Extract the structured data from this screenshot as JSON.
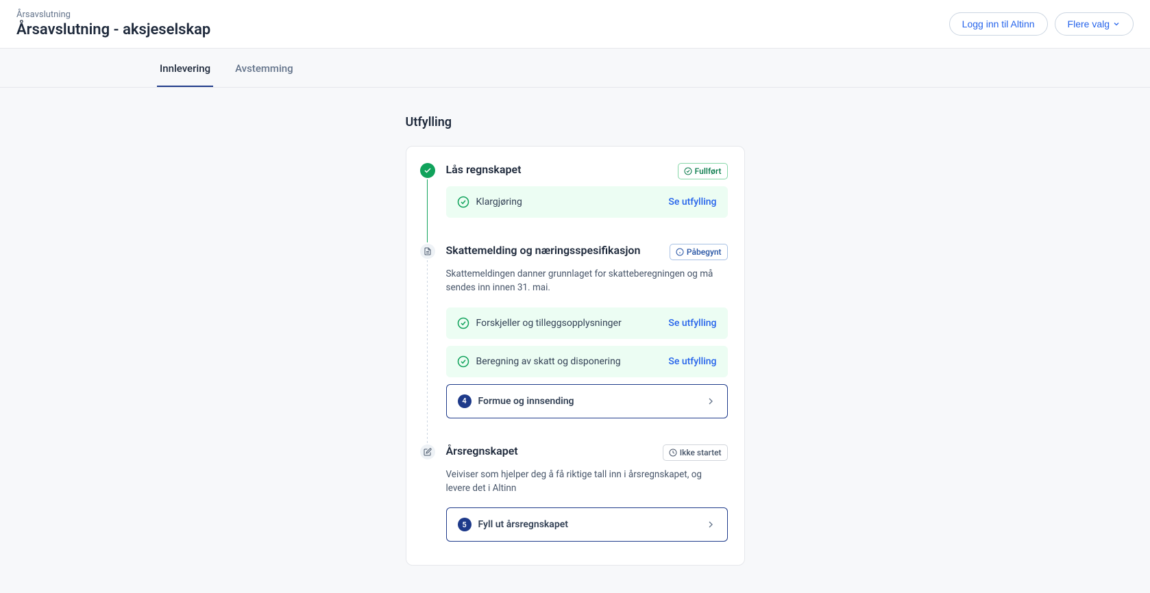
{
  "header": {
    "breadcrumb": "Årsavslutning",
    "title": "Årsavslutning - aksjeselskap",
    "btn_login": "Logg inn til Altinn",
    "btn_more": "Flere valg"
  },
  "tabs": {
    "innlevering": "Innlevering",
    "avstemming": "Avstemming"
  },
  "section": {
    "title": "Utfylling"
  },
  "steps": {
    "s1": {
      "title": "Lås regnskapet",
      "badge": "Fullført",
      "sub1": {
        "label": "Klargjøring",
        "link": "Se utfylling"
      }
    },
    "s2": {
      "title": "Skattemelding og næringsspesifikasjon",
      "badge": "Påbegynt",
      "desc": "Skattemeldingen danner grunnlaget for skatteberegningen og må sendes inn innen 31. mai.",
      "sub1": {
        "label": "Forskjeller og tilleggsopplysninger",
        "link": "Se utfylling"
      },
      "sub2": {
        "label": "Beregning av skatt og disponering",
        "link": "Se utfylling"
      },
      "sub3": {
        "num": "4",
        "label": "Formue og innsending"
      }
    },
    "s3": {
      "title": "Årsregnskapet",
      "badge": "Ikke startet",
      "desc": "Veiviser som hjelper deg å få riktige tall inn i årsregnskapet, og levere det i Altinn",
      "sub1": {
        "num": "5",
        "label": "Fyll ut årsregnskapet"
      }
    }
  }
}
